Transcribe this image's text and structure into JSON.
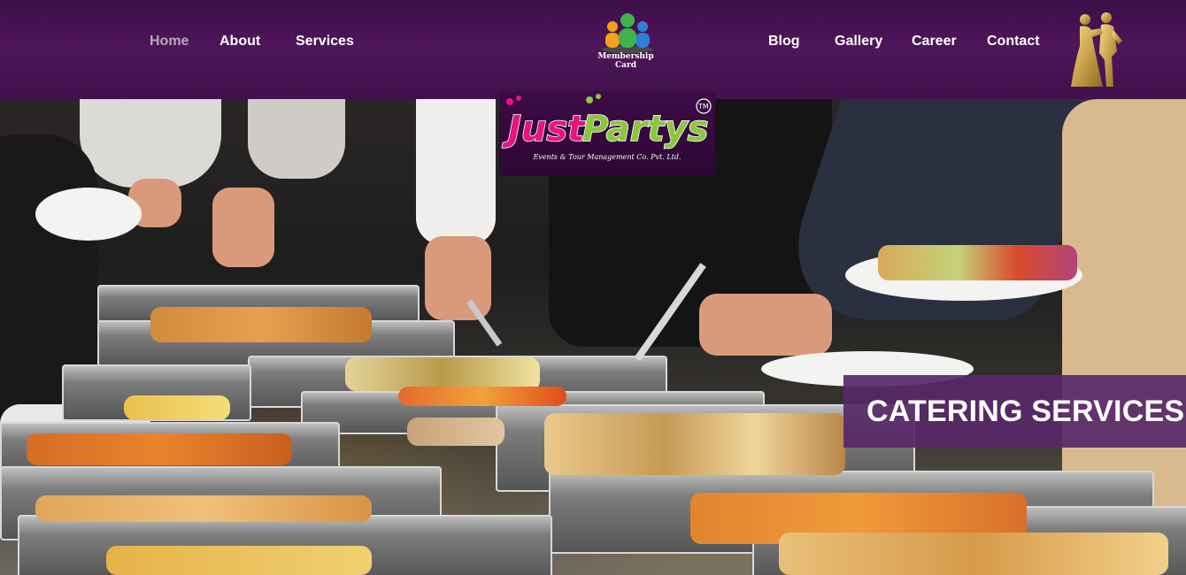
{
  "nav": {
    "left": [
      {
        "label": "Home",
        "active": true
      },
      {
        "label": "About",
        "active": false
      },
      {
        "label": "Services",
        "active": false
      }
    ],
    "right": [
      {
        "label": "Blog",
        "active": false
      },
      {
        "label": "Gallery",
        "active": false
      },
      {
        "label": "Career",
        "active": false
      },
      {
        "label": "Contact",
        "active": false
      }
    ]
  },
  "membership": {
    "line1": "Membership",
    "line2": "Card",
    "icon": "people-group-icon"
  },
  "brand": {
    "name": "Just Partys",
    "tm": "TM",
    "subtitle": "Events & Tour Management Co. Pvt. Ltd."
  },
  "hero": {
    "caption": "CATERING SERVICES",
    "image": "buffet-catering-photo"
  },
  "colors": {
    "header_bg": "#4a1256",
    "nav_text": "#ffffff",
    "nav_active": "#b7a9bb",
    "caption_bg": "#582868",
    "brand_pink": "#e6157d",
    "brand_green": "#8cc63f"
  }
}
